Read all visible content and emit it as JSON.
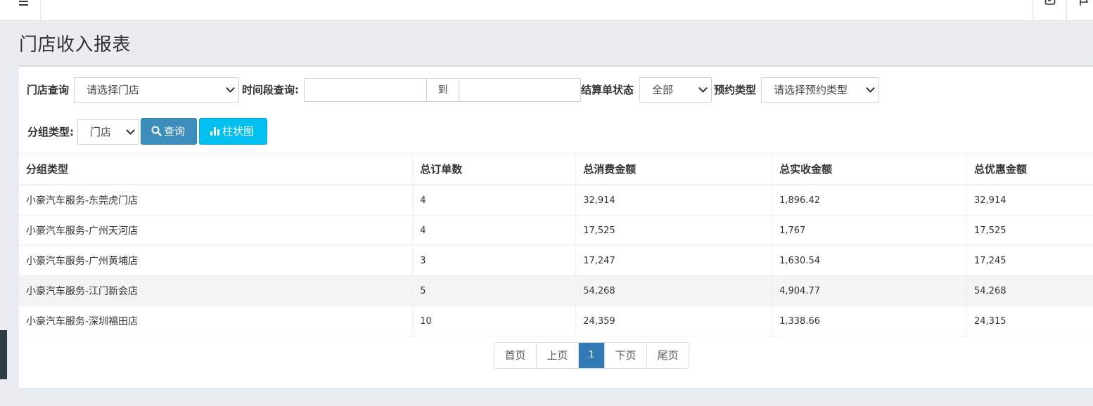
{
  "page": {
    "title": "门店收入报表"
  },
  "filters": {
    "store_label": "门店查询",
    "store_value": "请选择门店",
    "period_label": "时间段查询:",
    "period_to": "到",
    "period_start": "",
    "period_end": "",
    "status_label": "结算单状态",
    "status_value": "全部",
    "booking_label": "预约类型",
    "booking_value": "请选择预约类型",
    "group_label": "分组类型:",
    "group_value": "门店",
    "query_button": "查询",
    "chart_button": "柱状图"
  },
  "table": {
    "headers": [
      "分组类型",
      "总订单数",
      "总消费金额",
      "总实收金额",
      "总优惠金额"
    ],
    "rows": [
      [
        "小豪汽车服务-东莞虎门店",
        "4",
        "32,914",
        "1,896.42",
        "32,914"
      ],
      [
        "小豪汽车服务-广州天河店",
        "4",
        "17,525",
        "1,767",
        "17,525"
      ],
      [
        "小豪汽车服务-广州黄埔店",
        "3",
        "17,247",
        "1,630.54",
        "17,245"
      ],
      [
        "小豪汽车服务-江门新会店",
        "5",
        "54,268",
        "4,904.77",
        "54,268"
      ],
      [
        "小豪汽车服务-深圳福田店",
        "10",
        "24,359",
        "1,338.66",
        "24,315"
      ]
    ]
  },
  "pagination": {
    "first": "首页",
    "prev": "上页",
    "current": "1",
    "next": "下页",
    "last": "尾页"
  },
  "colors": {
    "primary": "#3c8dbc",
    "info": "#00c0ef",
    "active_page": "#337ab7"
  }
}
